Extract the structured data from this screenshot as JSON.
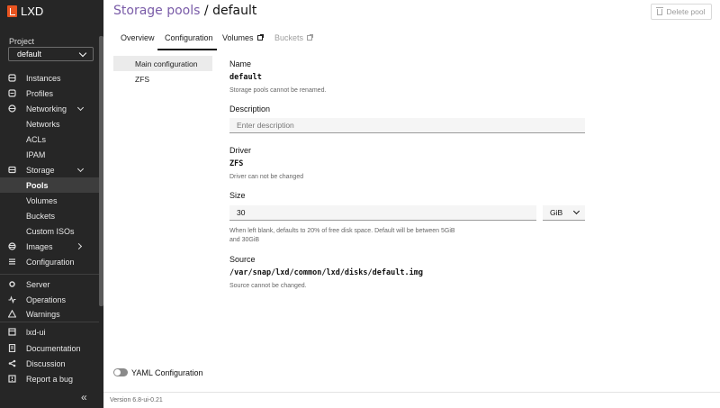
{
  "app": {
    "name": "LXD"
  },
  "sidebar": {
    "project_label": "Project",
    "project_value": "default",
    "items": [
      {
        "label": "Instances",
        "icon": "instances-icon"
      },
      {
        "label": "Profiles",
        "icon": "profiles-icon"
      },
      {
        "label": "Networking",
        "icon": "networking-icon"
      },
      {
        "label": "Networks"
      },
      {
        "label": "ACLs"
      },
      {
        "label": "IPAM"
      },
      {
        "label": "Storage",
        "icon": "storage-icon"
      },
      {
        "label": "Pools"
      },
      {
        "label": "Volumes"
      },
      {
        "label": "Buckets"
      },
      {
        "label": "Custom ISOs"
      },
      {
        "label": "Images",
        "icon": "images-icon"
      },
      {
        "label": "Configuration",
        "icon": "configuration-icon"
      },
      {
        "label": "Server",
        "icon": "server-icon"
      },
      {
        "label": "Operations",
        "icon": "operations-icon"
      },
      {
        "label": "Warnings",
        "icon": "warnings-icon"
      },
      {
        "label": "lxd-ui",
        "icon": "lxd-ui-icon"
      },
      {
        "label": "Documentation",
        "icon": "documentation-icon"
      },
      {
        "label": "Discussion",
        "icon": "discussion-icon"
      },
      {
        "label": "Report a bug",
        "icon": "bug-icon"
      }
    ],
    "collapse_glyph": "«"
  },
  "header": {
    "breadcrumb": "Storage pools",
    "separator": " / ",
    "current": "default",
    "delete_label": "Delete pool"
  },
  "tabs": [
    {
      "label": "Overview"
    },
    {
      "label": "Configuration",
      "active": true
    },
    {
      "label": "Volumes"
    },
    {
      "label": "Buckets",
      "disabled": true
    }
  ],
  "section_nav": [
    {
      "label": "Main configuration",
      "active": true
    },
    {
      "label": "ZFS"
    }
  ],
  "form": {
    "name_label": "Name",
    "name_value": "default",
    "name_help": "Storage pools cannot be renamed.",
    "description_label": "Description",
    "description_placeholder": "Enter description",
    "driver_label": "Driver",
    "driver_value": "ZFS",
    "driver_help": "Driver can not be changed",
    "size_label": "Size",
    "size_value": "30",
    "size_unit": "GiB",
    "size_help_1": "When left blank, defaults to 20% of free disk space. Default will be between 5GiB",
    "size_help_2": "and 30GiB",
    "source_label": "Source",
    "source_value": "/var/snap/lxd/common/lxd/disks/default.img",
    "source_help": "Source cannot be changed."
  },
  "yaml_toggle_label": "YAML Configuration",
  "footer": {
    "version": "Version 6.8-ui-0.21"
  },
  "colors": {
    "sidebar_bg": "#262626",
    "accent": "#7a5ca8",
    "brand": "#e95420"
  }
}
